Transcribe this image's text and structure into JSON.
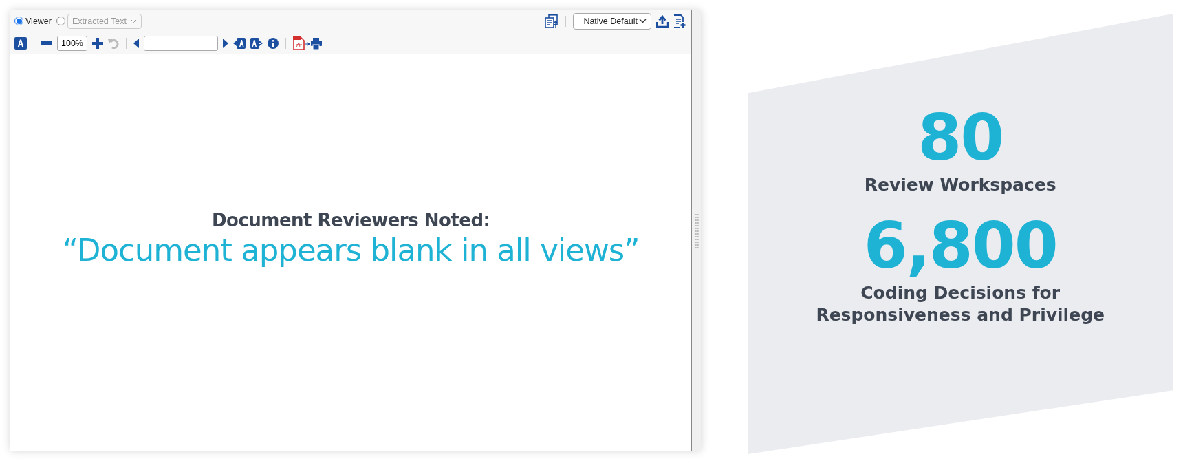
{
  "viewer": {
    "modes": [
      {
        "label": "Viewer",
        "selected": true,
        "kind": "plain"
      },
      {
        "label": "Extracted Text",
        "selected": false,
        "kind": "dropdown"
      }
    ],
    "profile_select": {
      "value": "Native Default"
    },
    "zoom_field": {
      "value": "100%"
    },
    "document": {
      "heading": "Document Reviewers Noted:",
      "quote": "“Document appears blank in all views”"
    }
  },
  "stats": [
    {
      "value": "80",
      "label": "Review Workspaces"
    },
    {
      "value": "6,800",
      "label": "Coding Decisions for\nResponsiveness and Privilege"
    }
  ]
}
